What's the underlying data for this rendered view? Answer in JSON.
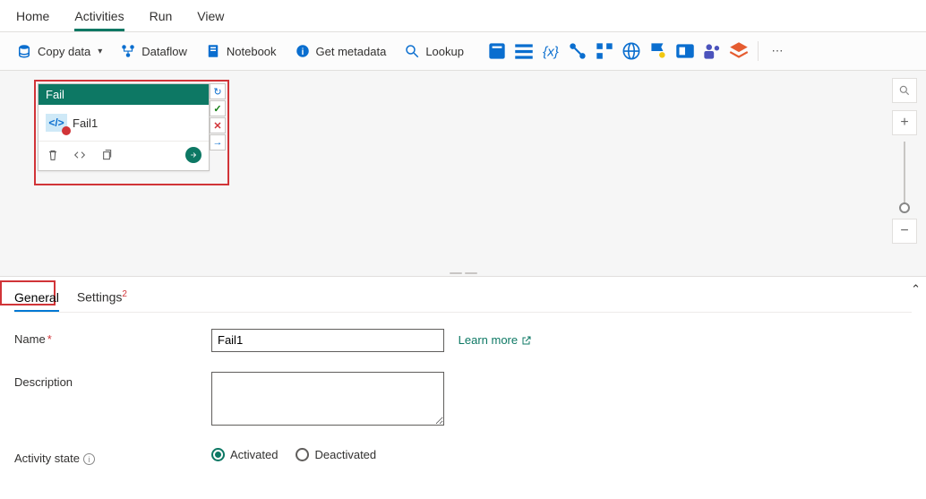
{
  "topTabs": {
    "home": "Home",
    "activities": "Activities",
    "run": "Run",
    "view": "View"
  },
  "toolbar": {
    "copyData": "Copy data",
    "dataflow": "Dataflow",
    "notebook": "Notebook",
    "getMetadata": "Get metadata",
    "lookup": "Lookup"
  },
  "activity": {
    "type": "Fail",
    "name": "Fail1"
  },
  "detailTabs": {
    "general": "General",
    "settings": "Settings",
    "settingsBadge": "2"
  },
  "form": {
    "nameLabel": "Name",
    "nameValue": "Fail1",
    "learnMore": "Learn more",
    "descLabel": "Description",
    "descValue": "",
    "stateLabel": "Activity state",
    "activated": "Activated",
    "deactivated": "Deactivated"
  }
}
